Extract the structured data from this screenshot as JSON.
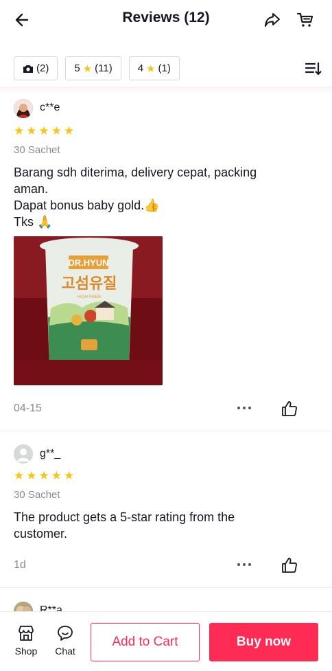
{
  "header": {
    "title": "Reviews (12)",
    "back_icon": "arrow-left-icon",
    "share_icon": "share-icon",
    "cart_icon": "cart-icon"
  },
  "filters": [
    {
      "label": "(2)",
      "icon": "camera-icon"
    },
    {
      "rating": "5",
      "label": "(11)",
      "icon": "star-icon"
    },
    {
      "rating": "4",
      "label": "(1)",
      "icon": "star-icon"
    }
  ],
  "sort_icon": "sort-icon",
  "colors": {
    "accent": "#fe2c55",
    "star": "#f7c518",
    "muted": "#8a8b91"
  },
  "reviews": [
    {
      "username": "c**e",
      "rating": 5,
      "variant": "30 Sachet",
      "lines": [
        "Barang sdh diterima, delivery cepat, packing",
        "aman.",
        "Dapat bonus baby gold.👍",
        "Tks 🙏"
      ],
      "photo": {
        "brand": "DR.HYUN",
        "text": "고섬유질",
        "sub": "HIGH FIBER"
      },
      "date": "04-15"
    },
    {
      "username": "g**_",
      "rating": 5,
      "variant": "30 Sachet",
      "lines": [
        "The product gets a 5-star rating from the",
        "customer."
      ],
      "date": "1d"
    },
    {
      "username": "R**a"
    }
  ],
  "bottom_bar": {
    "shop_label": "Shop",
    "chat_label": "Chat",
    "add_to_cart": "Add to Cart",
    "buy_now": "Buy now"
  }
}
